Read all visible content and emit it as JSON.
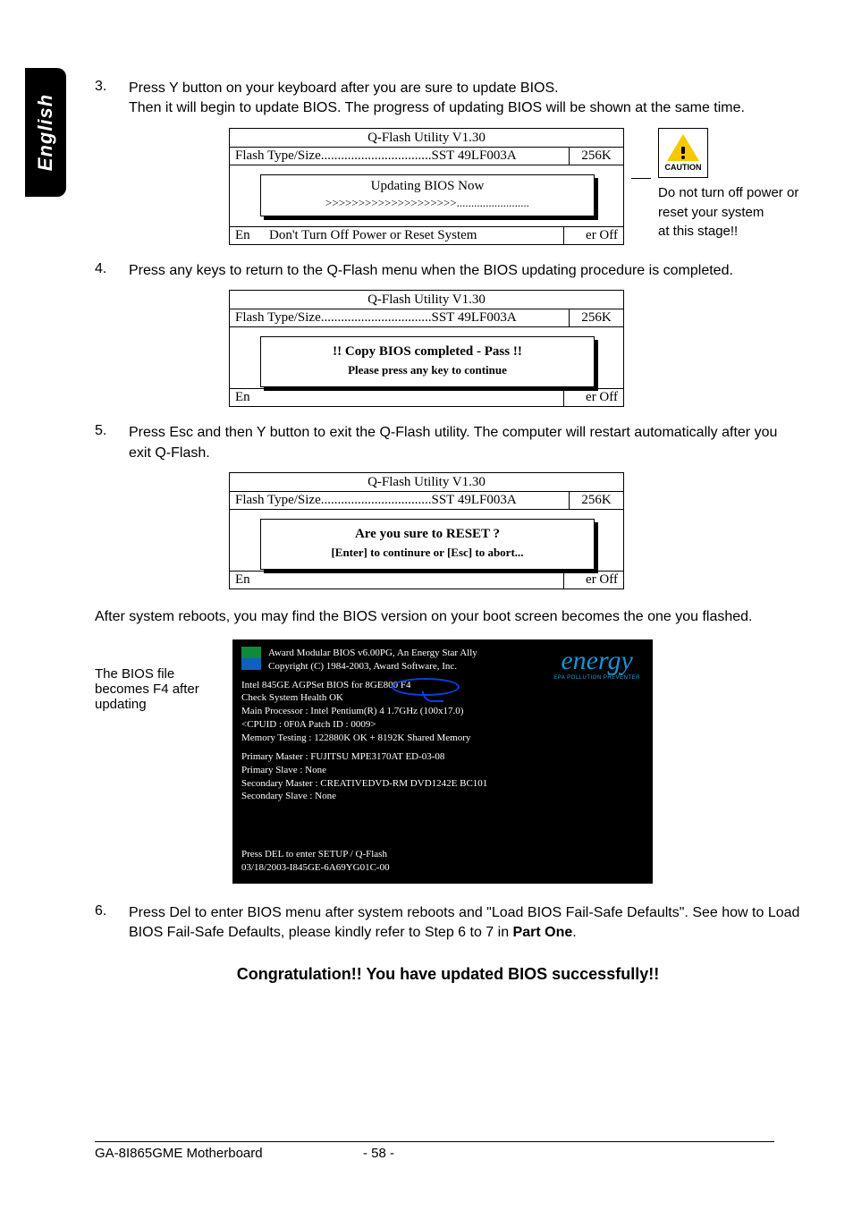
{
  "sideTab": "English",
  "steps": {
    "s3": {
      "num": "3.",
      "line1": "Press Y button on your keyboard after you are sure to update BIOS.",
      "line2": "Then it will begin to update BIOS. The progress of updating BIOS will be shown at the same time."
    },
    "s4": {
      "num": "4.",
      "text": "Press any keys to return to the Q-Flash menu when the BIOS updating procedure is completed."
    },
    "s5": {
      "num": "5.",
      "text": "Press Esc and then Y button to exit the Q-Flash utility. The computer will restart automatically after you exit Q-Flash."
    },
    "s6": {
      "num": "6.",
      "line1": "Press Del to enter BIOS menu after system reboots and \"Load BIOS Fail-Safe Defaults\". See how to Load BIOS Fail-Safe Defaults, please kindly refer to Step 6 to 7 in ",
      "part": "Part One",
      "tail": "."
    }
  },
  "afterReboot": "After system reboots, you may find the BIOS version on your boot screen becomes the one you flashed.",
  "biosNote": {
    "l1": "The BIOS file",
    "l2": "becomes F4 after",
    "l3": "updating"
  },
  "qbox": {
    "title": "Q-Flash Utility V1.30",
    "flashLabel": "Flash Type/Size.................................SST 49LF003A",
    "size": "256K",
    "enter": "En",
    "erOff": "er Off",
    "box1": {
      "t": "Updating BIOS Now",
      "s": ">>>>>>>>>>>>>>>>>>>>.........................",
      "foot": "Don't Turn Off Power or Reset System"
    },
    "box2": {
      "t": "!! Copy BIOS completed - Pass !!",
      "s": "Please press any key to continue"
    },
    "box3": {
      "t": "Are you sure to RESET ?",
      "s": "[Enter] to continure or [Esc] to abort..."
    }
  },
  "caution": {
    "label": "CAUTION",
    "l1": "Do not turn off power or",
    "l2": "reset your system",
    "l3": "at this stage!!"
  },
  "boot": {
    "award1": "Award Modular BIOS v6.00PG, An Energy Star Ally",
    "award2": "Copyright  (C) 1984-2003, Award Software,  Inc.",
    "l1a": "Intel 845GE AGPSet BIOS ",
    "l1b": "for 8GE800 F4",
    "l2": "Check System Health OK",
    "l3": "Main Processor : Intel Pentium(R) 4   1.7GHz (100x17.0)",
    "l4": "<CPUID : 0F0A Patch ID  : 0009>",
    "l5": "Memory Testing   :  122880K OK + 8192K Shared Memory",
    "l6": "Primary Master : FUJITSU MPE3170AT ED-03-08",
    "l7": "Primary Slave : None",
    "l8": "Secondary Master : CREATIVEDVD-RM DVD1242E BC101",
    "l9": "Secondary Slave : None",
    "f1": "Press DEL to enter SETUP / Q-Flash",
    "f2": "03/18/2003-I845GE-6A69YG01C-00",
    "energy": "energy",
    "energySub": "EPA  POLLUTION PREVENTER"
  },
  "congrats": "Congratulation!! You have updated BIOS successfully!!",
  "footer": {
    "left": "GA-8I865GME Motherboard",
    "page": "- 58 -"
  }
}
